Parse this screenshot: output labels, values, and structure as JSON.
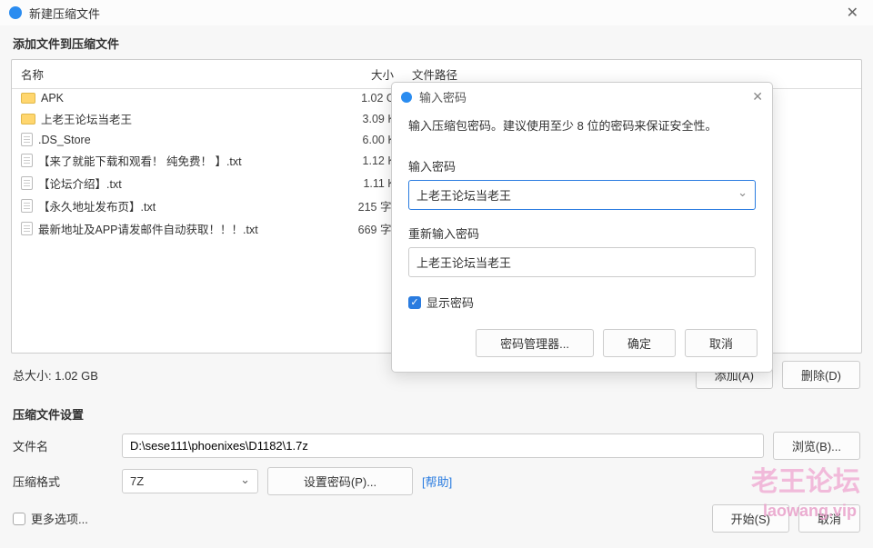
{
  "window": {
    "title": "新建压缩文件",
    "section_label": "添加文件到压缩文件"
  },
  "columns": {
    "name": "名称",
    "size": "大小",
    "path": "文件路径"
  },
  "files": [
    {
      "type": "folder",
      "name": "APK",
      "size": "1.02 GB"
    },
    {
      "type": "folder",
      "name": "上老王论坛当老王",
      "size": "3.09 KB"
    },
    {
      "type": "file",
      "name": ".DS_Store",
      "size": "6.00 KB"
    },
    {
      "type": "file",
      "name": "【来了就能下载和观看！ 纯免费！ 】.txt",
      "size": "1.12 KB"
    },
    {
      "type": "file",
      "name": "【论坛介绍】.txt",
      "size": "1.11 KB"
    },
    {
      "type": "file",
      "name": "【永久地址发布页】.txt",
      "size": "215 字节"
    },
    {
      "type": "file",
      "name": "最新地址及APP请发邮件自动获取！！！.txt",
      "size": "669 字节"
    }
  ],
  "footer": {
    "total_label": "总大小: 1.02 GB",
    "add_btn": "添加(A)",
    "delete_btn": "删除(D)"
  },
  "settings": {
    "label": "压缩文件设置",
    "filename_label": "文件名",
    "filename_value": "D:\\sese111\\phoenixes\\D1182\\1.7z",
    "browse_btn": "浏览(B)...",
    "format_label": "压缩格式",
    "format_value": "7Z",
    "setpwd_btn": "设置密码(P)...",
    "help_link": "[帮助]"
  },
  "bottom": {
    "more": "更多选项...",
    "start": "开始(S)",
    "cancel": "取消"
  },
  "dialog": {
    "title": "输入密码",
    "hint": "输入压缩包密码。建议使用至少 8 位的密码来保证安全性。",
    "pwd_label": "输入密码",
    "pwd_value": "上老王论坛当老王",
    "repwd_label": "重新输入密码",
    "repwd_value": "上老王论坛当老王",
    "show_pwd": "显示密码",
    "manager": "密码管理器...",
    "ok": "确定",
    "cancel": "取消"
  },
  "watermark": {
    "line1": "老王论坛",
    "line2": "laowang.vip"
  }
}
